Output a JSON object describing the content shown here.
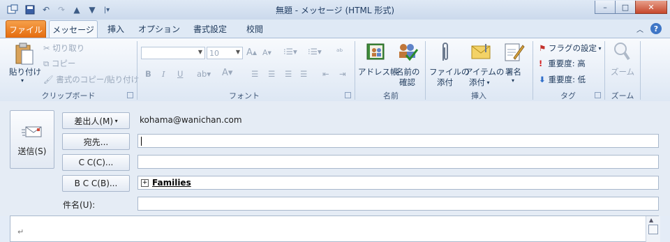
{
  "title": "無題 - メッセージ (HTML 形式)",
  "quick_access": {
    "icons": [
      "app-icon",
      "save-icon",
      "undo-icon",
      "redo-icon",
      "up-icon",
      "down-icon",
      "customize-icon"
    ]
  },
  "window_controls": {
    "minimize": "–",
    "maximize": "□",
    "close": "✕"
  },
  "tabs": [
    "ファイル",
    "メッセージ",
    "挿入",
    "オプション",
    "書式設定",
    "校閲"
  ],
  "ribbon": {
    "clipboard": {
      "paste": "貼り付け",
      "cut": "切り取り",
      "copy": "コピー",
      "format_painter": "書式のコピー/貼り付け",
      "label": "クリップボード"
    },
    "font": {
      "font_size": "10",
      "label": "フォント"
    },
    "names": {
      "address_book": "アドレス帳",
      "check_names_1": "名前の",
      "check_names_2": "確認",
      "label": "名前"
    },
    "include": {
      "attach_file_1": "ファイルの",
      "attach_file_2": "添付",
      "attach_item_1": "アイテムの",
      "attach_item_2": "添付",
      "signature": "署名",
      "label": "挿入"
    },
    "tags": {
      "follow_up": "フラグの設定",
      "high": "重要度: 高",
      "low": "重要度: 低",
      "label": "タグ"
    },
    "zoom": {
      "zoom": "ズーム",
      "label": "ズーム"
    }
  },
  "form": {
    "send": "送信(S)",
    "from_button": "差出人(M)",
    "from_value": "kohama@wanichan.com",
    "to_button": "宛先...",
    "to_value": "",
    "cc_button": "C C(C)...",
    "cc_value": "",
    "bcc_button": "B C C(B)...",
    "bcc_value": "Families",
    "subject_label": "件名(U):",
    "subject_value": ""
  },
  "body": {
    "text": "↵"
  }
}
